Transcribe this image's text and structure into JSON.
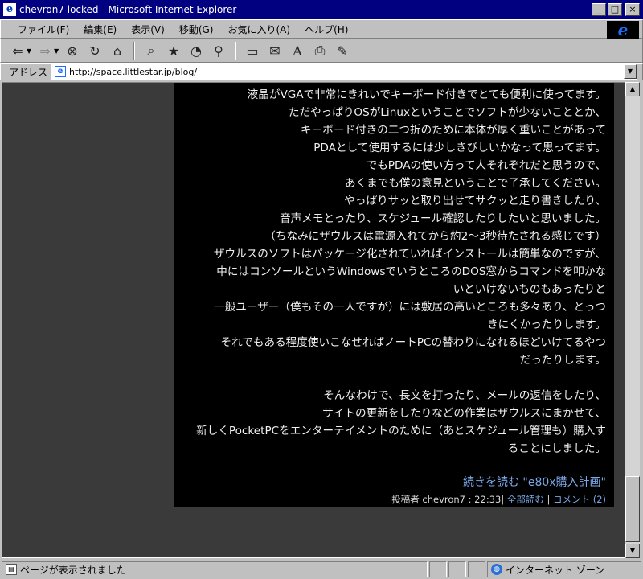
{
  "window": {
    "title": "chevron7 locked - Microsoft Internet Explorer",
    "icon": "ie-icon",
    "buttons": {
      "minimize": "_",
      "maximize": "□",
      "close": "×"
    }
  },
  "menu": {
    "items": [
      "ファイル(F)",
      "編集(E)",
      "表示(V)",
      "移動(G)",
      "お気に入り(A)",
      "ヘルプ(H)"
    ]
  },
  "toolbar": {
    "buttons": [
      "back-icon",
      "forward-icon",
      "stop-icon",
      "refresh-icon",
      "home-icon",
      "search-icon",
      "favorites-icon",
      "history-icon",
      "channels-icon",
      "fullscreen-icon",
      "mail-icon",
      "font-icon",
      "print-icon",
      "edit-icon"
    ]
  },
  "address": {
    "label": "アドレス",
    "url": "http://space.littlestar.jp/blog/"
  },
  "post": {
    "lines": [
      "液晶がVGAで非常にきれいでキーボード付きでとても便利に使ってます。",
      "ただやっぱりOSがLinuxということでソフトが少ないこととか、",
      "キーボード付きの二つ折のために本体が厚く重いことがあって",
      "PDAとして使用するには少しきびしいかなって思ってます。",
      "でもPDAの使い方って人それぞれだと思うので、",
      "あくまでも僕の意見ということで了承してください。",
      "やっぱりサッと取り出せてサクッと走り書きしたり、",
      "音声メモとったり、スケジュール確認したりしたいと思いました。",
      "（ちなみにザウルスは電源入れてから約2～3秒待たされる感じです）",
      "ザウルスのソフトはパッケージ化されていればインストールは簡単なのですが、",
      "中にはコンソールというWindowsでいうところのDOS窓からコマンドを叩かな",
      "いといけないものもあったりと",
      "一般ユーザー（僕もその一人ですが）には敷居の高いところも多々あり、とっつ",
      "きにくかったりします。",
      "それでもある程度使いこなせればノートPCの替わりになれるほどいけてるやつ",
      "だったりします。",
      "",
      "そんなわけで、長文を打ったり、メールの返信をしたり、",
      "サイトの更新をしたりなどの作業はザウルスにまかせて、",
      "新しくPocketPCをエンターテイメントのために（あとスケジュール管理も）購入す",
      "ることにしました。"
    ],
    "more_link": "続きを読む \"e80x購入計画\"",
    "meta": {
      "author_prefix": "投稿者 chevron7 : 22:33|",
      "permalink": "全部読む",
      "separator": "|",
      "comments": "コメント (2)"
    }
  },
  "status": {
    "message": "ページが表示されました",
    "zone": "インターネット ゾーン"
  },
  "colors": {
    "titlebar": "#000080",
    "chrome": "#c0c0c0",
    "page_bg": "#3a3a3a",
    "post_bg": "#000000",
    "link": "#7aa7e8"
  }
}
